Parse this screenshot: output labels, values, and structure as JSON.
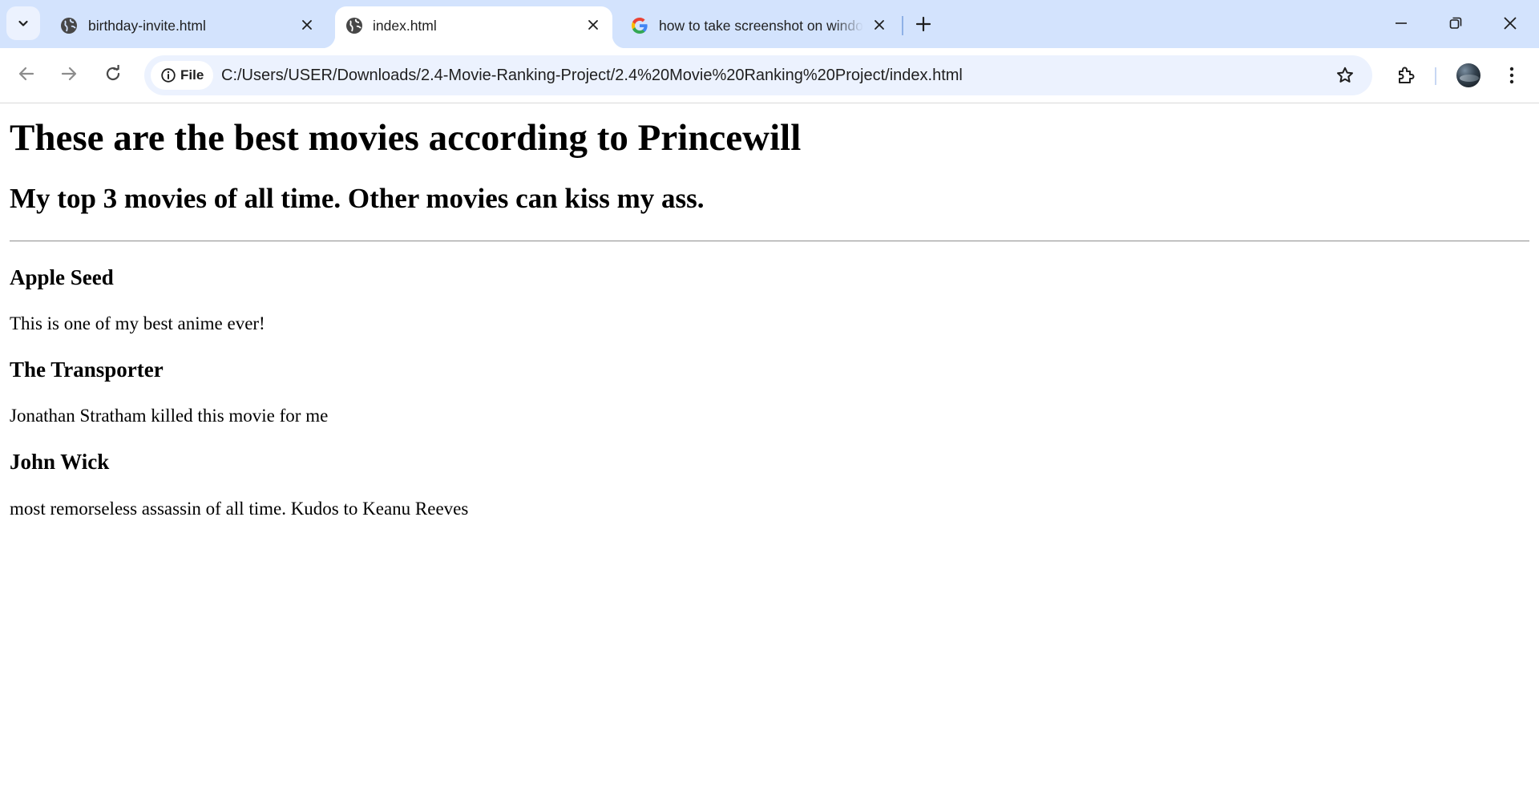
{
  "browser": {
    "tabs": [
      {
        "title": "birthday-invite.html",
        "favicon": "globe-icon",
        "active": false
      },
      {
        "title": "index.html",
        "favicon": "globe-icon",
        "active": true
      },
      {
        "title": "how to take screenshot on windows",
        "favicon": "google-icon",
        "active": false
      }
    ],
    "address_bar": {
      "chip_label": "File",
      "url": "C:/Users/USER/Downloads/2.4-Movie-Ranking-Project/2.4%20Movie%20Ranking%20Project/index.html"
    },
    "colors": {
      "tabstrip_bg": "#d3e3fd",
      "omnibox_bg": "#ecf2fe",
      "icon": "#474747"
    }
  },
  "page": {
    "heading": "These are the best movies according to Princewill",
    "subheading": "My top 3 movies of all time. Other movies can kiss my ass.",
    "movies": [
      {
        "title": "Apple Seed",
        "description": "This is one of my best anime ever!"
      },
      {
        "title": "The Transporter",
        "description": "Jonathan Stratham killed this movie for me"
      },
      {
        "title": "John Wick",
        "description": "most remorseless assassin of all time. Kudos to Keanu Reeves"
      }
    ]
  }
}
